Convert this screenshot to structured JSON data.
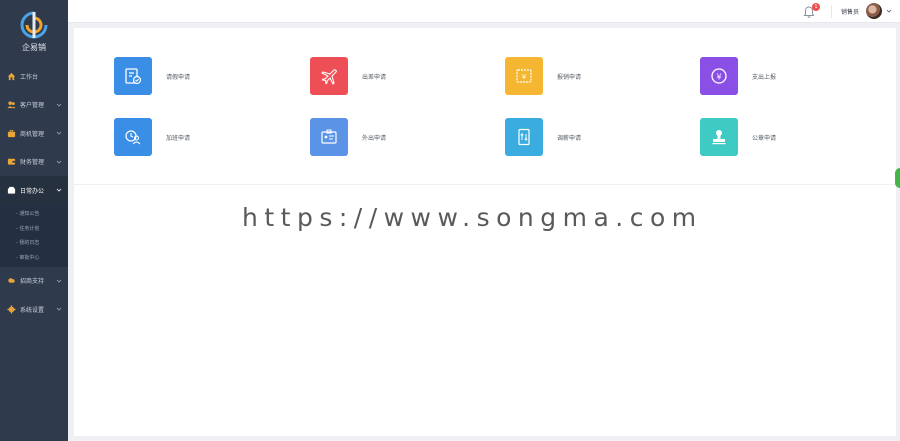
{
  "app": {
    "logo_text": "企易销",
    "brand_color": "#2f3b4c"
  },
  "sidebar": {
    "items": [
      {
        "label": "工作台",
        "icon": "home-icon",
        "has_caret": false
      },
      {
        "label": "客户管理",
        "icon": "users-icon",
        "has_caret": true
      },
      {
        "label": "商机管理",
        "icon": "briefcase-icon",
        "has_caret": true
      },
      {
        "label": "财务管理",
        "icon": "wallet-icon",
        "has_caret": true
      },
      {
        "label": "日常办公",
        "icon": "office-icon",
        "has_caret": true,
        "active": true
      }
    ],
    "submenu": [
      "通知公告",
      "任务计划",
      "我的日志",
      "审批中心"
    ],
    "items_after": [
      {
        "label": "招商支持",
        "icon": "cloud-icon",
        "has_caret": true
      },
      {
        "label": "系统设置",
        "icon": "gear-icon",
        "has_caret": true
      }
    ]
  },
  "topbar": {
    "notification_count": "1",
    "username": "销售员",
    "bell_icon": "bell-icon",
    "avatar_icon": "avatar"
  },
  "apps": [
    {
      "label": "请假申请",
      "color": "#3a8ee6",
      "icon": "leave-form-icon"
    },
    {
      "label": "出差申请",
      "color": "#ee4f56",
      "icon": "airplane-icon"
    },
    {
      "label": "报销申请",
      "color": "#f5b731",
      "icon": "reimburse-icon"
    },
    {
      "label": "支出上报",
      "color": "#8a4fe5",
      "icon": "yen-circle-icon"
    },
    {
      "label": "加班申请",
      "color": "#3a8ee6",
      "icon": "overtime-icon"
    },
    {
      "label": "外出申请",
      "color": "#5b93e6",
      "icon": "badge-card-icon"
    },
    {
      "label": "调薪申请",
      "color": "#3aace0",
      "icon": "salary-adjust-icon"
    },
    {
      "label": "公章申请",
      "color": "#3fcac4",
      "icon": "stamp-icon"
    }
  ],
  "watermark": "https://www.songma.com"
}
